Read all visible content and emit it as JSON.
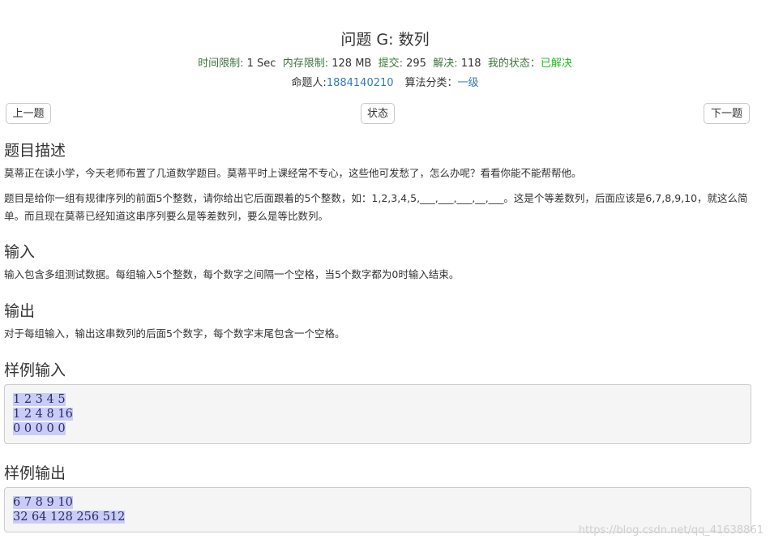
{
  "problem": {
    "title": "问题 G: 数列",
    "time_limit_label": "时间限制:",
    "time_limit": "1 Sec",
    "memory_limit_label": "内存限制:",
    "memory_limit": "128 MB",
    "submit_label": "提交:",
    "submit_count": "295",
    "solved_label": "解决:",
    "solved_count": "118",
    "my_status_label": "我的状态：",
    "my_status": "已解决",
    "author_label": "命题人:",
    "author": "1884140210",
    "category_label": "算法分类：",
    "category": "一级"
  },
  "nav": {
    "prev": "上一题",
    "status": "状态",
    "next": "下一题"
  },
  "sections": {
    "description_title": "题目描述",
    "description_p1": "莫蒂正在读小学，今天老师布置了几道数学题目。莫蒂平时上课经常不专心，这些他可发愁了，怎么办呢？看看你能不能帮帮他。",
    "description_p2": "题目是给你一组有规律序列的前面5个整数，请你给出它后面跟着的5个整数，如：1,2,3,4,5,___,___,___,__,___。这是个等差数列，后面应该是6,7,8,9,10，就这么简单。而且现在莫蒂已经知道这串序列要么是等差数列，要么是等比数列。",
    "input_title": "输入",
    "input_text": "输入包含多组测试数据。每组输入5个整数，每个数字之间隔一个空格，当5个数字都为0时输入结束。",
    "output_title": "输出",
    "output_text": "对于每组输入，输出这串数列的后面5个数字，每个数字末尾包含一个空格。",
    "sample_input_title": "样例输入",
    "sample_input": [
      "1 2 3 4 5",
      "1 2 4 8 16",
      "0 0 0 0 0"
    ],
    "sample_output_title": "样例输出",
    "sample_output": [
      "6 7 8 9 10",
      "32 64 128 256 512"
    ]
  },
  "watermark": "https://blog.csdn.net/qq_41638861"
}
